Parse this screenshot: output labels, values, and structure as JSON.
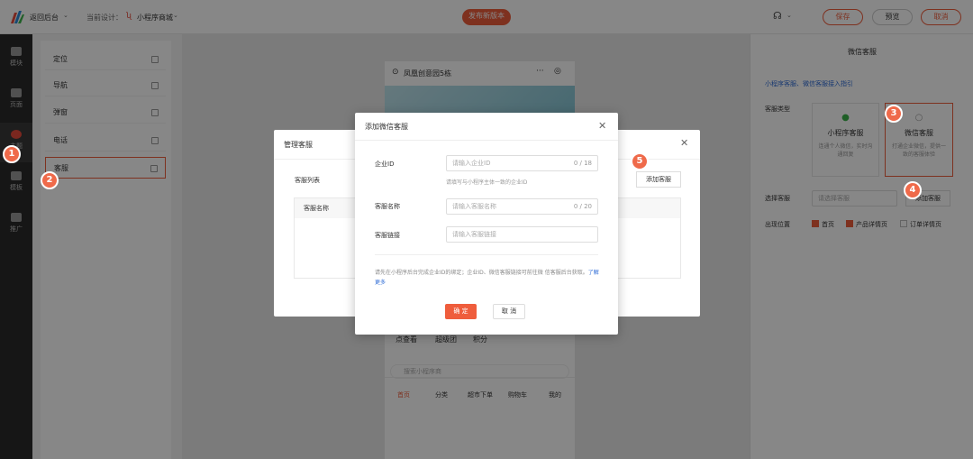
{
  "topbar": {
    "back_label": "返回后台",
    "current_design_label": "当前设计：",
    "design_name": "小程序商城",
    "publish_label": "发布新版本",
    "save_label": "保存",
    "preview_label": "预览",
    "cancel_label": "取消"
  },
  "leftnav": {
    "items": [
      {
        "label": "模块",
        "icon": "module-icon"
      },
      {
        "label": "页面",
        "icon": "page-icon"
      },
      {
        "label": "主题",
        "icon": "theme-icon"
      },
      {
        "label": "模板",
        "icon": "template-icon"
      },
      {
        "label": "推广",
        "icon": "promote-icon"
      }
    ]
  },
  "menu": {
    "items": [
      {
        "label": "定位"
      },
      {
        "label": "导航"
      },
      {
        "label": "弹窗"
      },
      {
        "label": "电话"
      },
      {
        "label": "客服"
      }
    ]
  },
  "phone": {
    "location": "凤凰创意园5栋",
    "tabs": [
      "首页",
      "分类",
      "超市下单",
      "购物车",
      "我的"
    ],
    "search_placeholder": "搜索小程序商",
    "row_labels": [
      "点查看",
      "超级团",
      "积分"
    ]
  },
  "right_panel": {
    "title": "微信客服",
    "link_text": "小程序客服、微信客服接入指引",
    "type_label": "客服类型",
    "card1_title": "小程序客服",
    "card1_desc": "连通个人微信，实时沟通回复",
    "card2_title": "微信客服",
    "card2_desc": "打通企业微信，提供一致的客服体验",
    "select_label": "选择客服",
    "select_placeholder": "请选择客服",
    "add_btn": "添加客服",
    "position_label": "出现位置",
    "positions": [
      {
        "label": "首页",
        "checked": true
      },
      {
        "label": "产品详情页",
        "checked": true
      },
      {
        "label": "订单详情页",
        "checked": false
      }
    ]
  },
  "manage_dialog": {
    "title": "管理客服",
    "list_label": "客服列表",
    "add_btn": "添加客服",
    "col_name": "客服名称"
  },
  "add_dialog": {
    "title": "添加微信客服",
    "corp_id_label": "企业ID",
    "corp_id_placeholder": "请输入企业ID",
    "corp_id_count": "0 / 18",
    "corp_id_hint": "请填写与小程序主体一致的企业ID",
    "name_label": "客服名称",
    "name_placeholder": "请输入客服名称",
    "name_count": "0 / 20",
    "link_label": "客服链接",
    "link_placeholder": "请输入客服链接",
    "note": "请先在小程序后台完成企业ID的绑定；企业ID、微信客服链接可前往微 信客服后台获取。",
    "learn_more": "了解更多",
    "confirm": "确 定",
    "cancel": "取 消"
  },
  "badges": [
    "1",
    "2",
    "3",
    "4",
    "5"
  ],
  "colors": {
    "accent": "#ef6a4a",
    "link": "#2f6cd6"
  }
}
